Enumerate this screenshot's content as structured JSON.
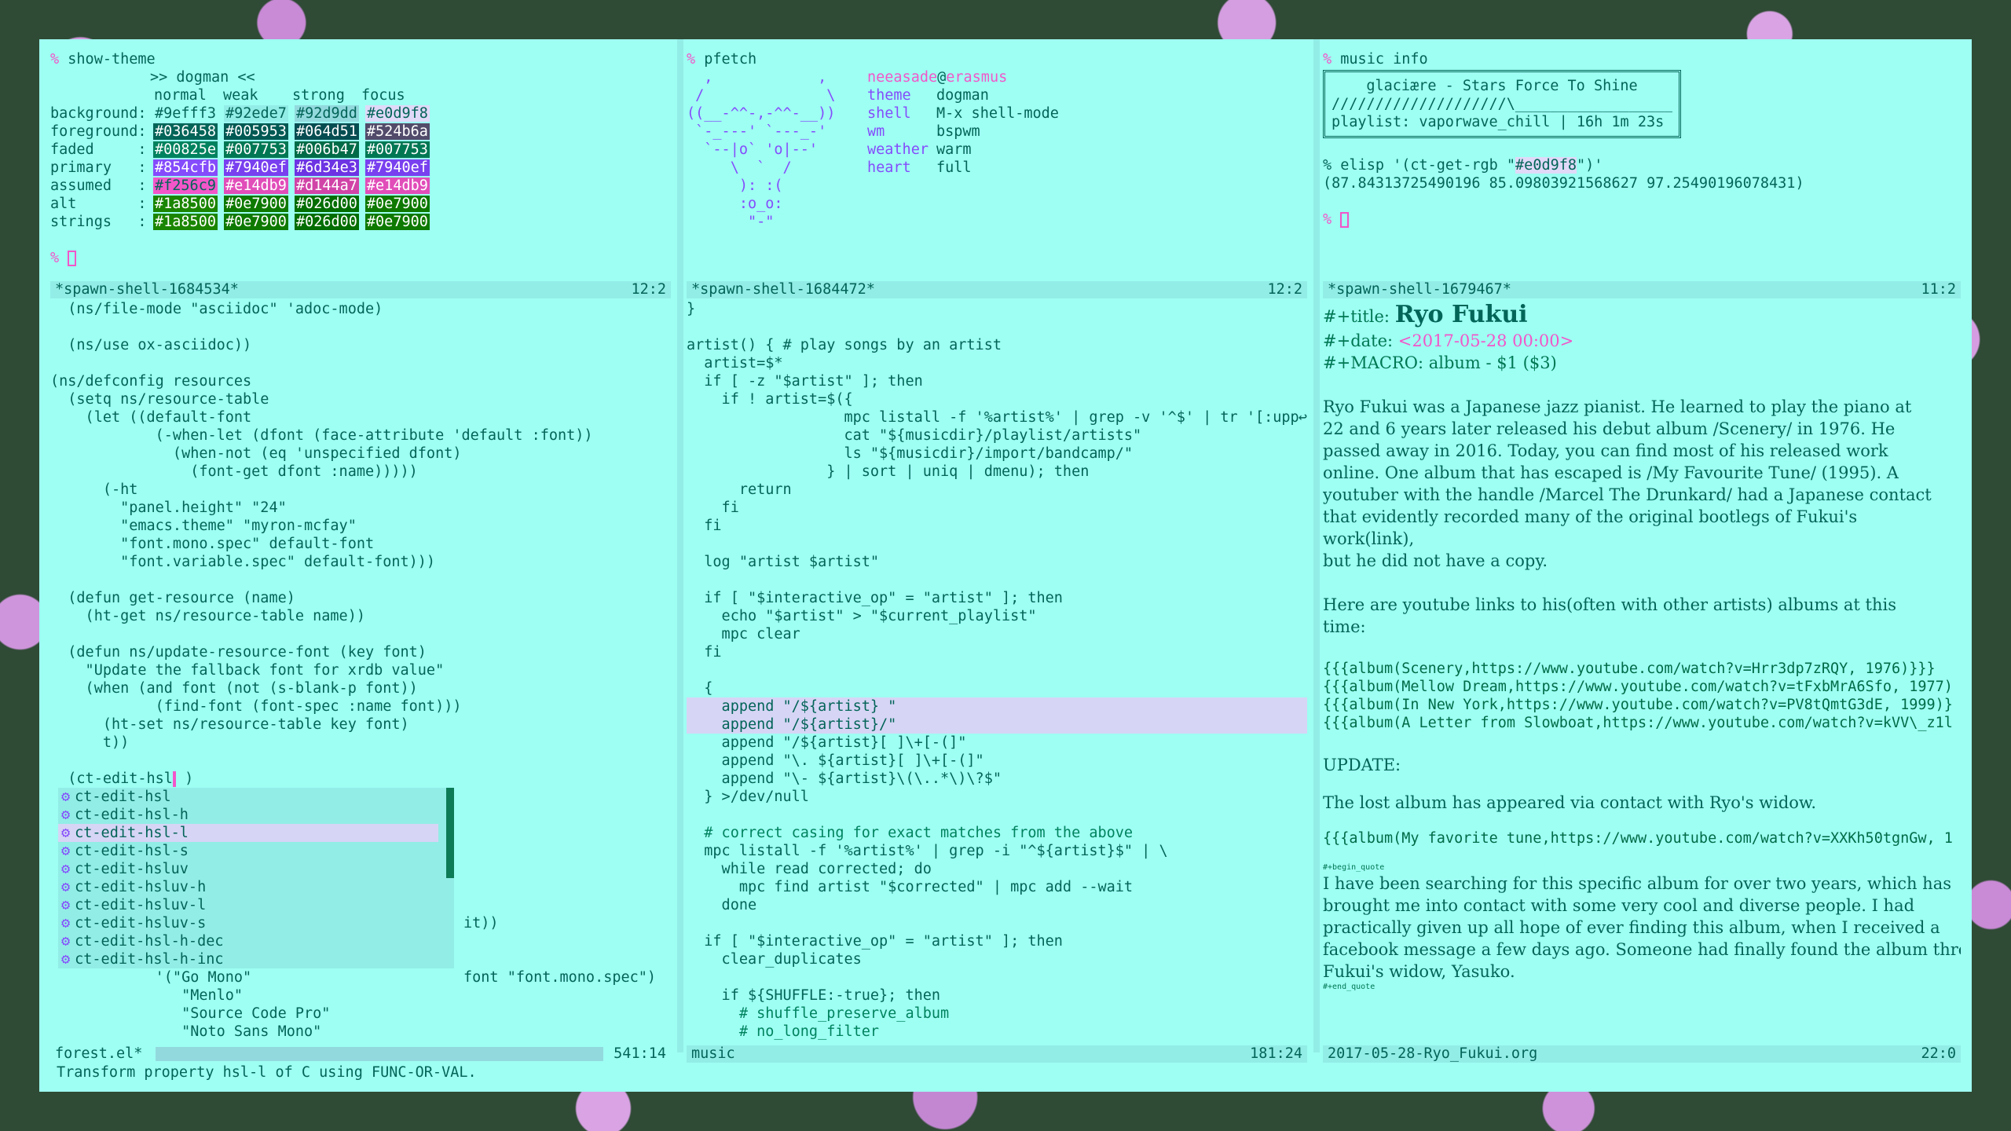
{
  "theme_pane": {
    "prompt": "% ",
    "command": "show-theme",
    "heading": ">> dogman <<",
    "columns": [
      "normal",
      "weak",
      "strong",
      "focus"
    ],
    "rows": [
      {
        "label": "background:",
        "vals": [
          "#9efff3",
          "#92ede7",
          "#92d9dd",
          "#e0d9f8"
        ],
        "bg": [
          "#9efff3",
          "#92ede7",
          "#92d9dd",
          "#e0d9f8"
        ],
        "fg": [
          "#036458",
          "#036458",
          "#036458",
          "#036458"
        ]
      },
      {
        "label": "foreground:",
        "vals": [
          "#036458",
          "#005953",
          "#064d51",
          "#524b6a"
        ],
        "bg": [
          "#036458",
          "#005953",
          "#064d51",
          "#524b6a"
        ],
        "fg": [
          "#ffffff",
          "#ffffff",
          "#ffffff",
          "#ffffff"
        ]
      },
      {
        "label": "faded     :",
        "vals": [
          "#00825e",
          "#007753",
          "#006b47",
          "#007753"
        ],
        "bg": [
          "#00825e",
          "#007753",
          "#006b47",
          "#007753"
        ],
        "fg": [
          "#ffffff",
          "#ffffff",
          "#ffffff",
          "#ffffff"
        ]
      },
      {
        "label": "primary   :",
        "vals": [
          "#854cfb",
          "#7940ef",
          "#6d34e3",
          "#7940ef"
        ],
        "bg": [
          "#854cfb",
          "#7940ef",
          "#6d34e3",
          "#7940ef"
        ],
        "fg": [
          "#ffffff",
          "#ffffff",
          "#ffffff",
          "#ffffff"
        ]
      },
      {
        "label": "assumed   :",
        "vals": [
          "#f256c9",
          "#e14db9",
          "#d144a7",
          "#e14db9"
        ],
        "bg": [
          "#f256c9",
          "#e14db9",
          "#d144a7",
          "#e14db9"
        ],
        "fg": [
          "#036458",
          "#ffffff",
          "#ffffff",
          "#ffffff"
        ]
      },
      {
        "label": "alt       :",
        "vals": [
          "#1a8500",
          "#0e7900",
          "#026d00",
          "#0e7900"
        ],
        "bg": [
          "#1a8500",
          "#0e7900",
          "#026d00",
          "#0e7900"
        ],
        "fg": [
          "#ffffff",
          "#ffffff",
          "#ffffff",
          "#ffffff"
        ]
      },
      {
        "label": "strings   :",
        "vals": [
          "#1a8500",
          "#0e7900",
          "#026d00",
          "#0e7900"
        ],
        "bg": [
          "#1a8500",
          "#0e7900",
          "#026d00",
          "#0e7900"
        ],
        "fg": [
          "#ffffff",
          "#ffffff",
          "#ffffff",
          "#ffffff"
        ]
      }
    ],
    "end_prompt": "% "
  },
  "pfetch_pane": {
    "prompt": "% ",
    "command": "pfetch",
    "art": [
      "  ,            ,",
      " /              \\",
      "((__-^^-,-^^-__))",
      " `-_---' `---_-'",
      "  `--|o` 'o|--'",
      "     \\  `  /",
      "      ): :(",
      "      :o_o:",
      "       \"-\""
    ],
    "user": "neeasade",
    "at": "@",
    "host": "erasmus",
    "info": [
      {
        "key": "theme",
        "value": "dogman"
      },
      {
        "key": "shell",
        "value": "M-x shell-mode"
      },
      {
        "key": "wm",
        "value": "bspwm"
      },
      {
        "key": "weather",
        "value": "warm"
      },
      {
        "key": "heart",
        "value": "full"
      }
    ],
    "end_prompt": "% "
  },
  "music_pane": {
    "prompt": "% ",
    "command": "music info",
    "box_title": "glaciære - Stars Force To Shine",
    "box_progress": "////////////////////\\___________________",
    "box_playlist": "playlist: vaporwave_chill | 16h 1m 23s",
    "elisp_prefix": "% elisp '(ct-get-rgb \"",
    "elisp_color": "#e0d9f8",
    "elisp_suffix": "\")'",
    "elisp_result": "(87.84313725490196 85.09803921568627 97.25490196078431)",
    "end_prompt": "% "
  },
  "top_modelines": [
    {
      "name": "*spawn-shell-1684534*",
      "pos": "12:2"
    },
    {
      "name": "*spawn-shell-1684472*",
      "pos": "12:2"
    },
    {
      "name": "*spawn-shell-1679467*",
      "pos": "11:2"
    }
  ],
  "elisp_pane": {
    "lines": [
      "  (ns/file-mode \"asciidoc\" 'adoc-mode)",
      "",
      "  (ns/use ox-asciidoc))",
      "",
      "(ns/defconfig resources",
      "  (setq ns/resource-table",
      "    (let ((default-font",
      "            (-when-let (dfont (face-attribute 'default :font))",
      "              (when-not (eq 'unspecified dfont)",
      "                (font-get dfont :name)))))",
      "      (-ht",
      "        \"panel.height\" \"24\"",
      "        \"emacs.theme\" \"myron-mcfay\"",
      "        \"font.mono.spec\" default-font",
      "        \"font.variable.spec\" default-font)))",
      "",
      "  (defun get-resource (name)",
      "    (ht-get ns/resource-table name))",
      "",
      "  (defun ns/update-resource-font (key font)",
      "    \"Update the fallback font for xrdb value\"",
      "    (when (and font (not (s-blank-p font))",
      "            (find-font (font-spec :name font)))",
      "      (ht-set ns/resource-table key font)",
      "      t))",
      "",
      "  (ct-edit-hsl",
      "",
      "",
      "",
      "",
      "",
      "",
      "",
      "",
      "",
      "",
      "            '(\"Go Mono\"",
      "               \"Menlo\"",
      "               \"Source Code Pro\"",
      "               \"Noto Sans Mono\""
    ],
    "completion_items": [
      "ct-edit-hsl",
      "ct-edit-hsl-h",
      "ct-edit-hsl-l",
      "ct-edit-hsl-s",
      "ct-edit-hsluv",
      "ct-edit-hsluv-h",
      "ct-edit-hsluv-l",
      "ct-edit-hsluv-s",
      "ct-edit-hsl-h-dec",
      "ct-edit-hsl-h-inc"
    ],
    "completion_icon": "⚙",
    "behind_text_1": "it))",
    "behind_text_2": "font \"font.mono.spec\")",
    "cursor_tail": " )",
    "modeline_name": "forest.el*",
    "modeline_pos": "541:14"
  },
  "shell_pane": {
    "lines": [
      "}",
      "",
      "artist() { # play songs by an artist",
      "  artist=$*",
      "  if [ -z \"$artist\" ]; then",
      "    if ! artist=$({",
      "                  mpc listall -f '%artist%' | grep -v '^$' | tr '[:upp",
      "                  cat \"${musicdir}/playlist/artists\"",
      "                  ls \"${musicdir}/import/bandcamp/\"",
      "                } | sort | uniq | dmenu); then",
      "      return",
      "    fi",
      "  fi",
      "",
      "  log \"artist $artist\"",
      "",
      "  if [ \"$interactive_op\" = \"artist\" ]; then",
      "    echo \"$artist\" > \"$current_playlist\"",
      "    mpc clear",
      "  fi",
      "",
      "  {",
      "    append \"/${artist} \"",
      "    append \"/${artist}/\"",
      "    append \"/${artist}[ ]\\+[-(]\"",
      "    append \"\\. ${artist}[ ]\\+[-(]\"",
      "    append \"\\- ${artist}\\(\\..*\\)\\?$\"",
      "  } >/dev/null",
      "",
      "  # correct casing for exact matches from the above",
      "  mpc listall -f '%artist%' | grep -i \"^${artist}$\" | \\",
      "    while read corrected; do",
      "      mpc find artist \"$corrected\" | mpc add --wait",
      "    done",
      "",
      "  if [ \"$interactive_op\" = \"artist\" ]; then",
      "    clear_duplicates",
      "",
      "    if ${SHUFFLE:-true}; then",
      "      # shuffle_preserve_album",
      "      # no_long_filter"
    ],
    "continuation": "↩",
    "modeline_name": "music",
    "modeline_pos": "181:24"
  },
  "org_pane": {
    "title_key": "#+title: ",
    "title": "Ryo Fukui",
    "date_key": "#+date: ",
    "date": "<2017-05-28 00:00>",
    "macro": "#+MACRO: album - $1 ($3)",
    "para1": [
      "Ryo Fukui was a Japanese jazz pianist. He learned to play the piano at",
      "22 and 6 years later released his debut album /Scenery/ in 1976. He",
      "passed away in 2016. Today, you can find most of his released work",
      "online. One album that has escaped is /My Favourite Tune/ (1995). A",
      "youtuber with the handle /Marcel The Drunkard/ had a Japanese contact",
      "that evidently recorded many of the original bootlegs of Fukui's",
      "work(link),",
      "but he did not have a copy."
    ],
    "para2": [
      "Here are youtube links to his(often with other artists) albums at this",
      "time:"
    ],
    "albums": [
      "{{{album(Scenery,https://www.youtube.com/watch?v=Hrr3dp7zRQY, 1976)}}}",
      "{{{album(Mellow Dream,https://www.youtube.com/watch?v=tFxbMrA6Sfo, 1977)",
      "{{{album(In New York,https://www.youtube.com/watch?v=PV8tQmtG3dE, 1999)}",
      "{{{album(A Letter from Slowboat,https://www.youtube.com/watch?v=kVV\\_z1l"
    ],
    "update": "UPDATE:",
    "lost": "The lost album has appeared via contact with Ryo's widow.",
    "album5": "{{{album(My favorite tune,https://www.youtube.com/watch?v=XXKh50tgnGw, 1",
    "begin_quote": "#+begin_quote",
    "quote": [
      "I have been searching for this specific album for over two years, which has",
      "brought me into contact with some very cool and diverse people. I had",
      "practically given up all hope of ever finding this album, when I received a",
      "facebook message a few days ago. Someone had finally found the album through Ryo",
      "Fukui's widow, Yasuko."
    ],
    "end_quote": "#+end_quote",
    "modeline_name": "2017-05-28-Ryo_Fukui.org",
    "modeline_pos": "22:0"
  },
  "echo_area": "Transform property hsl-l of C using FUNC-OR-VAL."
}
